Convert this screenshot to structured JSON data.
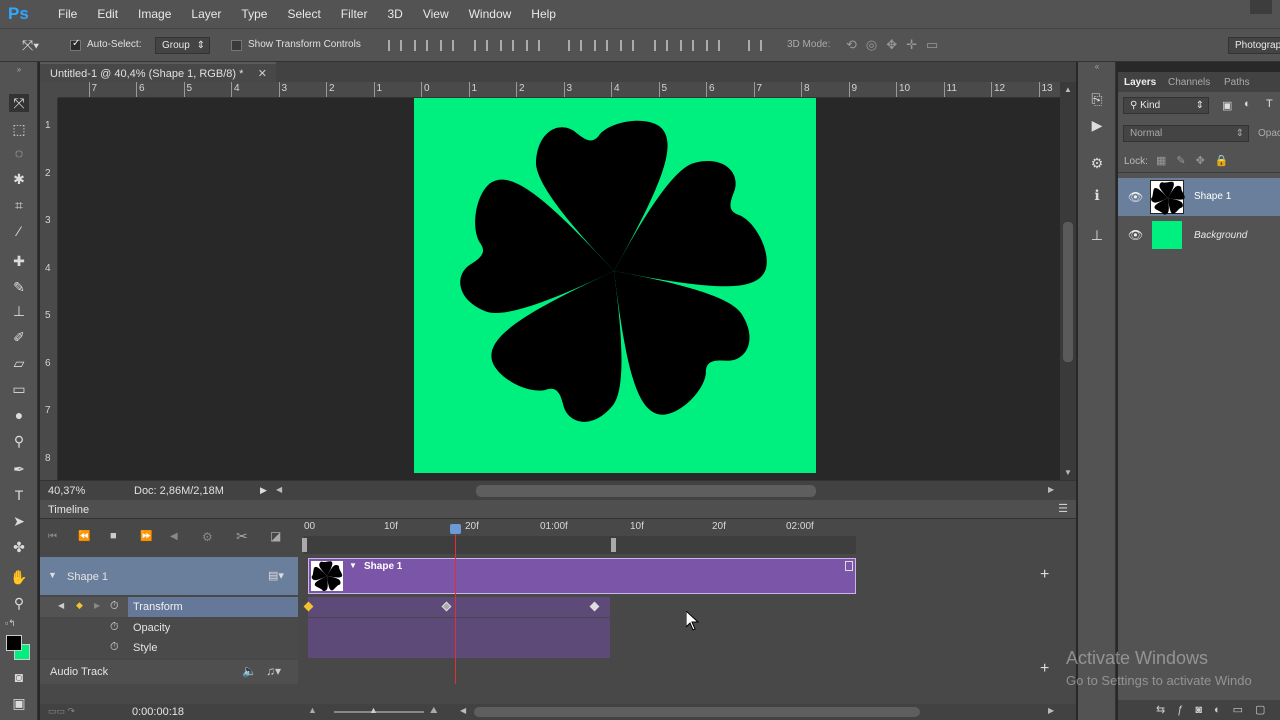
{
  "app": {
    "logo": "Ps",
    "brand_color": "#31a8ff"
  },
  "menu": [
    "File",
    "Edit",
    "Image",
    "Layer",
    "Type",
    "Select",
    "Filter",
    "3D",
    "View",
    "Window",
    "Help"
  ],
  "options": {
    "auto_select_label": "Auto-Select:",
    "auto_select_value": "Group",
    "show_transform_label": "Show Transform Controls",
    "mode_3d_label": "3D Mode:",
    "workspace": "Photograp"
  },
  "document": {
    "tab_title": "Untitled-1 @ 40,4% (Shape 1, RGB/8) *",
    "canvas_color": "#00f080",
    "shape_color": "#000000",
    "h_ruler": [
      "7",
      "6",
      "5",
      "4",
      "3",
      "2",
      "1",
      "0",
      "1",
      "2",
      "3",
      "4",
      "5",
      "6",
      "7",
      "8",
      "9",
      "10",
      "11",
      "12",
      "13"
    ],
    "v_ruler": [
      "1",
      "2",
      "3",
      "4",
      "5",
      "6",
      "7",
      "8"
    ]
  },
  "status": {
    "zoom": "40,37%",
    "doc_info": "Doc: 2,86M/2,18M"
  },
  "timeline": {
    "title": "Timeline",
    "ticks": [
      "00",
      "10f",
      "20f",
      "01:00f",
      "10f",
      "20f",
      "02:00f"
    ],
    "layer_name": "Shape 1",
    "clip_name": "Shape 1",
    "clip_color": "#7b55a8",
    "properties": [
      "Transform",
      "Opacity",
      "Style"
    ],
    "audio_track": "Audio Track",
    "current_time": "0:00:00:18"
  },
  "layers_panel": {
    "tabs": [
      "Layers",
      "Channels",
      "Paths"
    ],
    "filter": "Kind",
    "blend_mode": "Normal",
    "opacity_label": "Opac",
    "lock_label": "Lock:",
    "layers": [
      {
        "name": "Shape 1",
        "selected": true
      },
      {
        "name": "Background",
        "selected": false,
        "italic": true
      }
    ]
  },
  "watermark": {
    "line1": "Activate Windows",
    "line2": "Go to Settings to activate Windo"
  }
}
